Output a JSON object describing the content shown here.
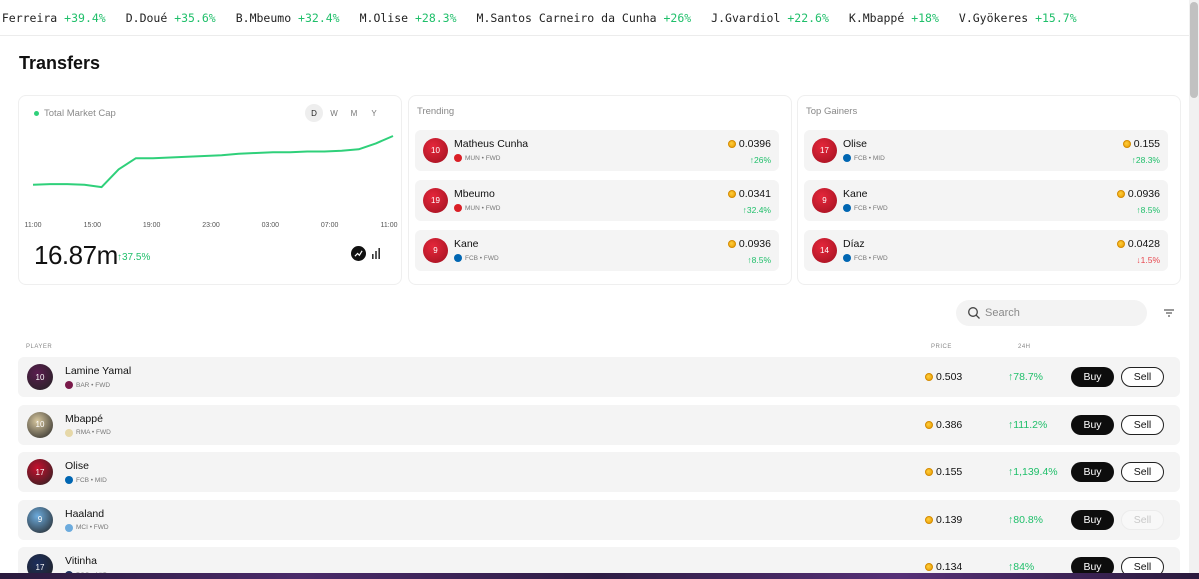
{
  "ticker": [
    {
      "name": "o Ferreira",
      "change": "+39.4%"
    },
    {
      "name": "D.Doué",
      "change": "+35.6%"
    },
    {
      "name": "B.Mbeumo",
      "change": "+32.4%"
    },
    {
      "name": "M.Olise",
      "change": "+28.3%"
    },
    {
      "name": "M.Santos Carneiro da Cunha",
      "change": "+26%"
    },
    {
      "name": "J.Gvardiol",
      "change": "+22.6%"
    },
    {
      "name": "K.Mbappé",
      "change": "+18%"
    },
    {
      "name": "V.Gyökeres",
      "change": "+15.7%"
    }
  ],
  "page": {
    "title": "Transfers"
  },
  "market_cap": {
    "label": "Total Market Cap",
    "periods": [
      "D",
      "W",
      "M",
      "Y"
    ],
    "active_period": "D",
    "value": "16.87m",
    "change": "↑37.5%",
    "accent_color": "#2fd07a",
    "chart_data": {
      "type": "line",
      "x_ticks": [
        "11:00",
        "15:00",
        "19:00",
        "23:00",
        "03:00",
        "07:00",
        "11:00"
      ],
      "values": [
        0.34,
        0.35,
        0.35,
        0.34,
        0.31,
        0.55,
        0.7,
        0.7,
        0.71,
        0.72,
        0.73,
        0.74,
        0.76,
        0.77,
        0.78,
        0.78,
        0.79,
        0.79,
        0.8,
        0.82,
        0.9,
        1.0
      ],
      "grid": false
    }
  },
  "trending": {
    "title": "Trending",
    "items": [
      {
        "name": "Matheus Cunha",
        "number": "10",
        "club": "MUN",
        "position": "FWD",
        "price": "0.0396",
        "change": "↑26%",
        "direction": "up",
        "club_color": "#da1f26"
      },
      {
        "name": "Mbeumo",
        "number": "19",
        "club": "MUN",
        "position": "FWD",
        "price": "0.0341",
        "change": "↑32.4%",
        "direction": "up",
        "club_color": "#da1f26"
      },
      {
        "name": "Kane",
        "number": "9",
        "club": "FCB",
        "position": "FWD",
        "price": "0.0936",
        "change": "↑8.5%",
        "direction": "up",
        "club_color": "#0066b2"
      }
    ]
  },
  "top_gainers": {
    "title": "Top Gainers",
    "items": [
      {
        "name": "Olise",
        "number": "17",
        "club": "FCB",
        "position": "MID",
        "price": "0.155",
        "change": "↑28.3%",
        "direction": "up",
        "club_color": "#0066b2"
      },
      {
        "name": "Kane",
        "number": "9",
        "club": "FCB",
        "position": "FWD",
        "price": "0.0936",
        "change": "↑8.5%",
        "direction": "up",
        "club_color": "#0066b2"
      },
      {
        "name": "Díaz",
        "number": "14",
        "club": "FCB",
        "position": "FWD",
        "price": "0.0428",
        "change": "↓1.5%",
        "direction": "down",
        "club_color": "#0066b2"
      }
    ]
  },
  "search": {
    "placeholder": "Search",
    "value": ""
  },
  "table": {
    "headers": {
      "player": "PLAYER",
      "price": "PRICE",
      "change": "24H"
    },
    "buy_label": "Buy",
    "sell_label": "Sell",
    "rows": [
      {
        "name": "Lamine Yamal",
        "number": "10",
        "club": "BAR",
        "position": "FWD",
        "price": "0.503",
        "change": "↑78.7%",
        "sell_enabled": true,
        "kit_color": "#5a1d4f",
        "club_color": "#7a1a4a"
      },
      {
        "name": "Mbappé",
        "number": "10",
        "club": "RMA",
        "position": "FWD",
        "price": "0.386",
        "change": "↑111.2%",
        "sell_enabled": true,
        "kit_color": "#d9c9a0",
        "club_color": "#e6d8a8"
      },
      {
        "name": "Olise",
        "number": "17",
        "club": "FCB",
        "position": "MID",
        "price": "0.155",
        "change": "↑1,139.4%",
        "sell_enabled": true,
        "kit_color": "#c8102e",
        "club_color": "#0066b2"
      },
      {
        "name": "Haaland",
        "number": "9",
        "club": "MCI",
        "position": "FWD",
        "price": "0.139",
        "change": "↑80.8%",
        "sell_enabled": false,
        "kit_color": "#6cabdd",
        "club_color": "#6cabdd"
      },
      {
        "name": "Vitinha",
        "number": "17",
        "club": "PSG",
        "position": "MID",
        "price": "0.134",
        "change": "↑84%",
        "sell_enabled": true,
        "kit_color": "#1c2e5c",
        "club_color": "#1c2e5c"
      }
    ]
  }
}
